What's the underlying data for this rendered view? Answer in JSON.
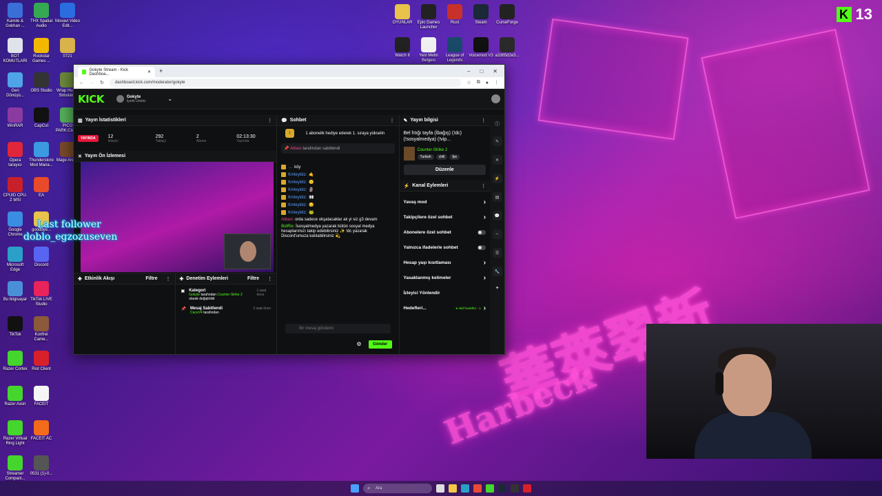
{
  "desktop": {
    "icons_left": [
      {
        "label": "Kamile & Gokhan ...",
        "color": "#3a6fd8"
      },
      {
        "label": "THX Spatial Audio",
        "color": "#35a852"
      },
      {
        "label": "Movavi Video Edit...",
        "color": "#2a6de0"
      },
      {
        "label": "BOT KOMUTLARI",
        "color": "#e0e4ea"
      },
      {
        "label": "Rockstar Games ...",
        "color": "#f2b800"
      },
      {
        "label": "0721",
        "color": "#d8b24a"
      },
      {
        "label": "Geri Dönüşü...",
        "color": "#4fa4e8"
      },
      {
        "label": "OBS Studio",
        "color": "#333333"
      },
      {
        "label": "Wrap Hou... Simulator",
        "color": "#6c8a3a"
      },
      {
        "label": "WinRAR",
        "color": "#8b3aa0"
      },
      {
        "label": "CapCut",
        "color": "#111111"
      },
      {
        "label": "PICO PARK:Clas...",
        "color": "#55b05a"
      },
      {
        "label": "Opera tarayıcı",
        "color": "#e0263a"
      },
      {
        "label": "Thunderstore Mod Mana...",
        "color": "#3a9be0"
      },
      {
        "label": "Mage Arena",
        "color": "#7a4a2a"
      },
      {
        "label": "CPUID CPU-Z MSI",
        "color": "#c8202a"
      },
      {
        "label": "EA",
        "color": "#e84a2a"
      },
      {
        "label": "Google Chrome",
        "color": "#3a8de0"
      },
      {
        "label": "goodbye...",
        "color": "#e8c24a"
      },
      {
        "label": "Microsoft Edge",
        "color": "#2aa0c8"
      },
      {
        "label": "Discord",
        "color": "#5865f2"
      },
      {
        "label": "Bu bilgisayar",
        "color": "#4a90d8"
      },
      {
        "label": "TikTok LIVE Studio",
        "color": "#e8245a"
      },
      {
        "label": "TikTok",
        "color": "#111111"
      },
      {
        "label": "Konfrei Came...",
        "color": "#8a5a3a"
      },
      {
        "label": "Razer Cortex",
        "color": "#44d62c"
      },
      {
        "label": "Riot Client",
        "color": "#d8202a"
      },
      {
        "label": "Razer Axon",
        "color": "#44d62c"
      },
      {
        "label": "FACEIT",
        "color": "#f5f5f5"
      },
      {
        "label": "Razer Virtual Ring Light",
        "color": "#44d62c"
      },
      {
        "label": "FACEIT AC",
        "color": "#f26a1a"
      },
      {
        "label": "Streamer Compani...",
        "color": "#44d62c"
      },
      {
        "label": "0531 (1)-0...",
        "color": "#555555"
      }
    ],
    "icons_top": [
      {
        "label": "OYUNLAR",
        "color": "#e8c24a"
      },
      {
        "label": "Epic Games Launcher",
        "color": "#222222"
      },
      {
        "label": "Rust",
        "color": "#c8302a"
      },
      {
        "label": "Steam",
        "color": "#1b2838"
      },
      {
        "label": "CurseForge",
        "color": "#222222"
      },
      {
        "label": "Watch It",
        "color": "#222222"
      },
      {
        "label": "Yeni Metin Belgesi",
        "color": "#f0f0f0"
      },
      {
        "label": "League of Legends",
        "color": "#1a4a6a"
      },
      {
        "label": "Voicemod V3",
        "color": "#111111"
      },
      {
        "label": "a2d65d2e3...",
        "color": "#2a2a2a"
      }
    ],
    "kick_badge_number": "13",
    "overlay_last_follower_label": "Last follower",
    "overlay_last_follower_name": "doblo_egzozuseven"
  },
  "browser": {
    "tab_title": "Gokyte Stream - Kick Dashboa...",
    "url": "dashboard.kick.com/moderator/gokyte",
    "window_controls": [
      "–",
      "□",
      "✕"
    ]
  },
  "kick": {
    "logo": "KICK",
    "user_name": "Gokyte",
    "user_role": "İçerik Üretici",
    "stats_panel": {
      "title": "Yayın İstatistikleri",
      "live_label": "YAYINDA",
      "stats": [
        {
          "value": "12",
          "label": "İzleyici"
        },
        {
          "value": "292",
          "label": "Takipçi"
        },
        {
          "value": "2",
          "label": "Abone"
        },
        {
          "value": "02:13:30",
          "label": "Yayında"
        }
      ]
    },
    "preview_title": "Yayın Ön İzlemesi",
    "activity_title": "Etkinlik Akışı",
    "activity_filter": "Filtre",
    "mod_title": "Denetim Eylemleri",
    "mod_filter": "Filtre",
    "mod_events": [
      {
        "title": "Kategori",
        "actor": "Gokyte",
        "text": "tarafından",
        "target": "Counter-Strike 2",
        "extra": "olarak değiştirildi",
        "time": "1 saat önce"
      },
      {
        "title": "Mesaj Sabitlendi",
        "actor": "CaceV4",
        "text": "tarafından",
        "target": "",
        "extra": "",
        "time": "2 saat önce"
      }
    ],
    "chat": {
      "title": "Sohbet",
      "gift_banner": "1 abonelik hediye ederek 1. sıraya yükselin",
      "pinned_by": "Atbasi",
      "pinned_text": "tarafından sabitlendi",
      "messages": [
        {
          "name": "…",
          "text": "köy"
        },
        {
          "name": "Kmleyldiz:",
          "text": "🤙"
        },
        {
          "name": "Kmleyldiz:",
          "text": "🙂"
        },
        {
          "name": "Kmleyldiz:",
          "text": "🗿"
        },
        {
          "name": "Kmleyldiz:",
          "text": "👀"
        },
        {
          "name": "Kmleyldiz:",
          "text": "😏"
        },
        {
          "name": "Kmleyldiz:",
          "text": "🐸"
        }
      ],
      "msg_atbasi_name": "Atbasi:",
      "msg_atbasi_text": "orda sadece okşatacaklar ak yi siz g3 devam",
      "msg_bot_name": "BotRix:",
      "msg_bot_text": "İsosyalmedya yazarak bütün sosyal medya hesaplarımızı takip edebilirsiniz ✨ !dc yazarak Discord'umuza katılabilirsiniz 💫",
      "input_placeholder": "Bir mesaj gönderin",
      "send_label": "Gönder"
    },
    "info": {
      "title": "Yayın bilgisi",
      "stream_title": "Bel fıtığı tayfa (İbağış) (!dc) (!sosyalmedya) (!vip...",
      "category": "Counter-Strike 2",
      "tags": [
        "Turkish",
        "chill",
        "fps"
      ],
      "edit_label": "Düzenle",
      "actions_title": "Kanal Eylemleri",
      "actions": [
        {
          "label": "Yavaş mod",
          "control": "chevron"
        },
        {
          "label": "Takipçilere özel sohbet",
          "control": "chevron"
        },
        {
          "label": "Abonelere özel sohbet",
          "control": "toggle"
        },
        {
          "label": "Yalnızca ifadelerle sohbet",
          "control": "toggle"
        },
        {
          "label": "Hesap yaşı kısıtlaması",
          "control": "chevron"
        },
        {
          "label": "Yasaklanmış kelimeler",
          "control": "chevron"
        },
        {
          "label": "İzleyici Yönlendir",
          "control": "none"
        },
        {
          "label": "Hedefleri...",
          "control": "chevron",
          "note": "● Aktif hedefler - 1"
        }
      ]
    }
  },
  "taskbar": {
    "search_placeholder": "Ara"
  }
}
